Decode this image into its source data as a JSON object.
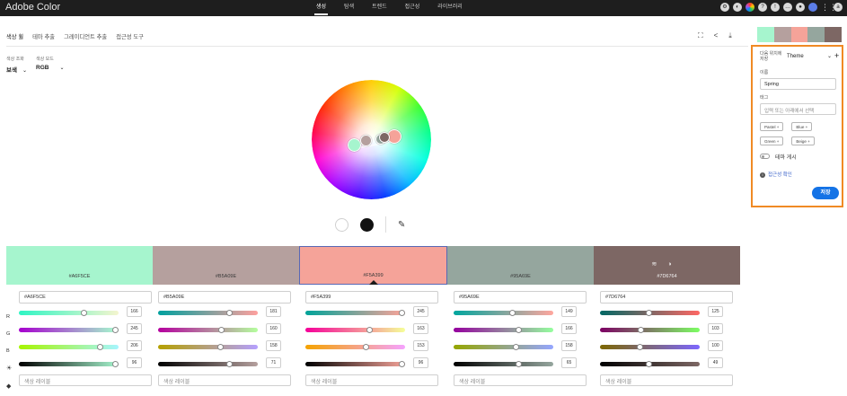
{
  "topbar": {
    "brand": "Adobe Color",
    "nav": [
      "생성",
      "탐색",
      "트렌드",
      "접근성",
      "라이브러리"
    ],
    "active_nav": 0
  },
  "tabs": [
    "색상 휠",
    "테마 추출",
    "그레이디언트 추출",
    "접근성 도구"
  ],
  "controls": {
    "harmony_label": "색상 조화",
    "harmony_value": "보색",
    "mode_label": "색상 모드",
    "mode_value": "RGB"
  },
  "swatches": [
    {
      "hex": "#A6F5CE",
      "color": "#A6F5CE",
      "r": 166,
      "g": 245,
      "b": 206,
      "brightness": 96,
      "label_placeholder": "색상 레이블"
    },
    {
      "hex": "#B5A09E",
      "color": "#B5A09E",
      "r": 181,
      "g": 160,
      "b": 158,
      "brightness": 71,
      "label_placeholder": "색상 레이블"
    },
    {
      "hex": "#F5A399",
      "color": "#F5A399",
      "r": 245,
      "g": 163,
      "b": 153,
      "brightness": 96,
      "label_placeholder": "색상 레이블"
    },
    {
      "hex": "#95A69E",
      "color": "#95A69E",
      "r": 149,
      "g": 166,
      "b": 158,
      "brightness": 65,
      "label_placeholder": "색상 레이블"
    },
    {
      "hex": "#7D6764",
      "color": "#7D6764",
      "r": 125,
      "g": 103,
      "b": 100,
      "brightness": 49,
      "label_placeholder": "색상 레이블"
    }
  ],
  "selected_swatch": 2,
  "row_labels": {
    "r": "R",
    "g": "G",
    "b": "B"
  },
  "panel": {
    "library_label": "다음 위치에 저장",
    "library_value": "Theme",
    "name_label": "이름",
    "name_value": "Spring",
    "tags_label": "태그",
    "tags_placeholder": "입력 또는 아래에서 선택",
    "chips": [
      "Pastel",
      "Blue",
      "Green",
      "Beige"
    ],
    "publish_label": "테마 게시",
    "accessibility_link": "접근성 확인",
    "save_label": "저장"
  },
  "icons": {
    "fullscreen": "fullscreen-icon",
    "share": "share-icon",
    "download": "download-icon",
    "eyedropper": "eyedropper-icon",
    "settings": "settings-icon",
    "brightness": "brightness-icon",
    "tag": "tag-icon"
  }
}
